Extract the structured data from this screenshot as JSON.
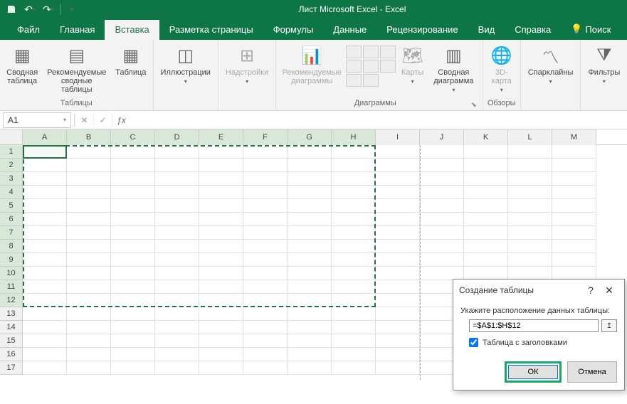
{
  "title": "Лист Microsoft Excel - Excel",
  "tabs": {
    "file": "Файл",
    "home": "Главная",
    "insert": "Вставка",
    "layout": "Разметка страницы",
    "formulas": "Формулы",
    "data": "Данные",
    "review": "Рецензирование",
    "view": "Вид",
    "help": "Справка",
    "search": "Поиск"
  },
  "active_tab": "insert",
  "ribbon": {
    "tables": {
      "pivot": "Сводная\nтаблица",
      "rec_pivot": "Рекомендуемые\nсводные таблицы",
      "table": "Таблица",
      "group": "Таблицы"
    },
    "illustrations": {
      "label": "Иллюстрации"
    },
    "addins": {
      "label": "Надстройки"
    },
    "charts": {
      "rec": "Рекомендуемые\nдиаграммы",
      "maps": "Карты",
      "pivot_chart": "Сводная\nдиаграмма",
      "group": "Диаграммы"
    },
    "tours": {
      "map3d": "3D-\nкарта",
      "group": "Обзоры"
    },
    "sparklines": {
      "label": "Спарклайны"
    },
    "filters": {
      "label": "Фильтры"
    }
  },
  "name_box": "A1",
  "columns": [
    "A",
    "B",
    "C",
    "D",
    "E",
    "F",
    "G",
    "H",
    "I",
    "J",
    "K",
    "L",
    "M"
  ],
  "rows": [
    1,
    2,
    3,
    4,
    5,
    6,
    7,
    8,
    9,
    10,
    11,
    12,
    13,
    14,
    15,
    16,
    17
  ],
  "selection_range": "A1:H12",
  "dialog": {
    "title": "Создание таблицы",
    "prompt": "Укажите расположение данных таблицы:",
    "range": "=$A$1:$H$12",
    "checkbox": "Таблица с заголовками",
    "checked": true,
    "ok": "ОК",
    "cancel": "Отмена"
  }
}
